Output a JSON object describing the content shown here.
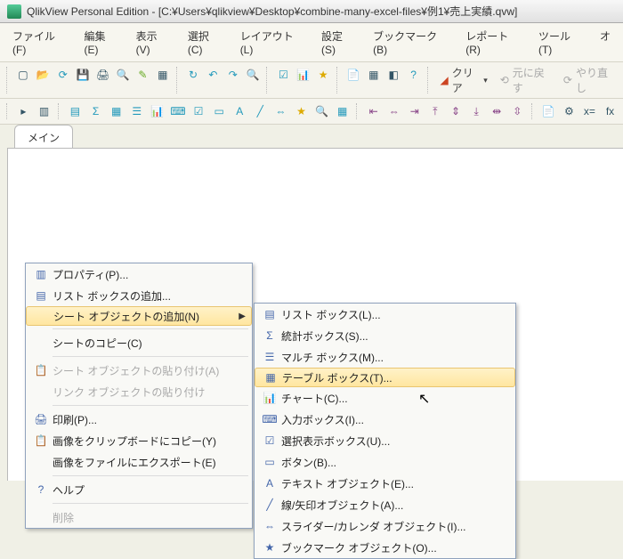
{
  "title": "QlikView Personal Edition - [C:¥Users¥qlikview¥Desktop¥combine-many-excel-files¥例1¥売上実績.qvw]",
  "menubar": [
    "ファイル(F)",
    "編集(E)",
    "表示(V)",
    "選択(C)",
    "レイアウト(L)",
    "設定(S)",
    "ブックマーク(B)",
    "レポート(R)",
    "ツール(T)",
    "オ"
  ],
  "toolbar2": {
    "clear": "クリア",
    "undo": "元に戻す",
    "redo": "やり直し"
  },
  "tab": "メイン",
  "ctx1": {
    "properties": "プロパティ(P)...",
    "addlistbox": "リスト ボックスの追加...",
    "addsheetobj": "シート オブジェクトの追加(N)",
    "copysheet": "シートのコピー(C)",
    "pastesheetobj": "シート オブジェクトの貼り付け(A)",
    "pastelinkobj": "リンク オブジェクトの貼り付け",
    "print": "印刷(P)...",
    "copyimg": "画像をクリップボードにコピー(Y)",
    "exportimg": "画像をファイルにエクスポート(E)",
    "help": "ヘルプ",
    "delete": "削除"
  },
  "ctx2": {
    "listbox": "リスト ボックス(L)...",
    "statbox": "統計ボックス(S)...",
    "multibox": "マルチ ボックス(M)...",
    "tablebox": "テーブル ボックス(T)...",
    "chart": "チャート(C)...",
    "inputbox": "入力ボックス(I)...",
    "selectdisplay": "選択表示ボックス(U)...",
    "button": "ボタン(B)...",
    "textobj": "テキスト オブジェクト(E)...",
    "lineobj": "線/矢印オブジェクト(A)...",
    "sliderobj": "スライダー/カレンダ オブジェクト(I)...",
    "bookmarkobj": "ブックマーク オブジェクト(O)..."
  }
}
